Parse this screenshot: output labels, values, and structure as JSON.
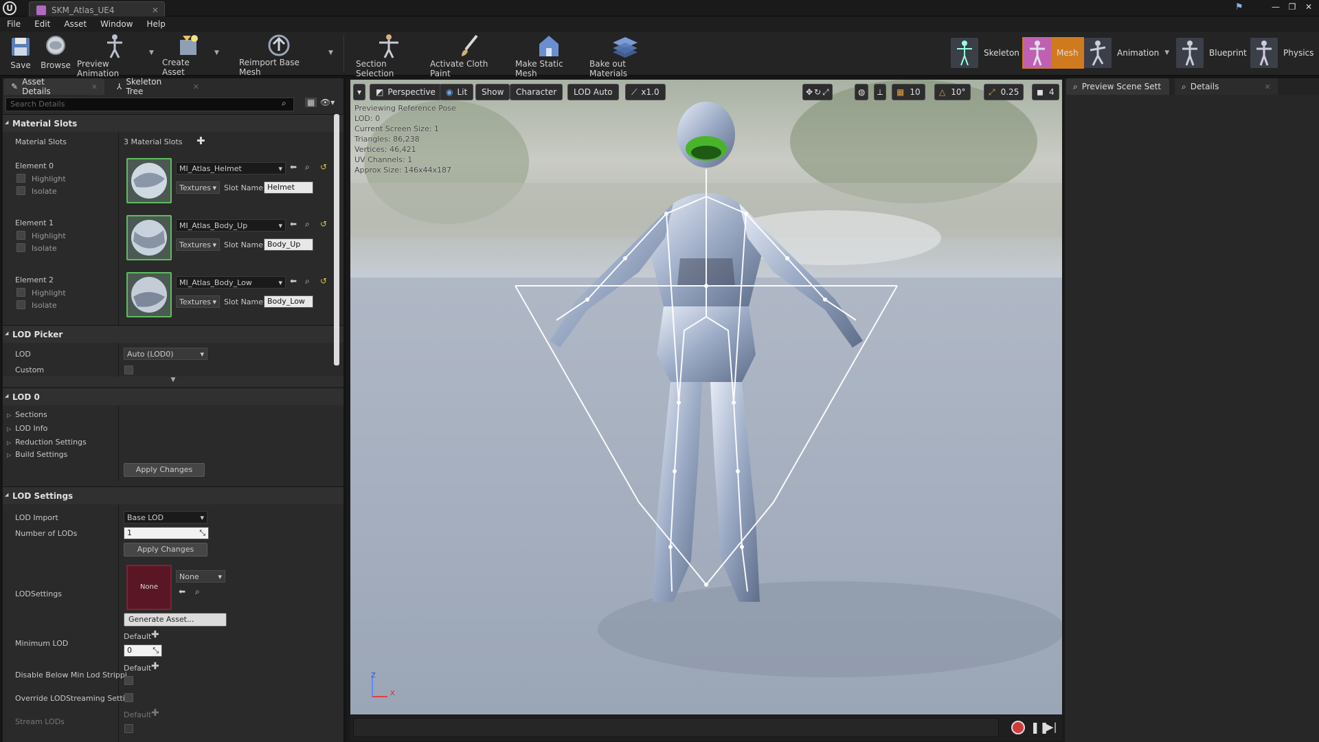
{
  "window": {
    "tab_title": "SKM_Atlas_UE4",
    "controls": [
      "—",
      "❐",
      "✕"
    ]
  },
  "menu": [
    "File",
    "Edit",
    "Asset",
    "Window",
    "Help"
  ],
  "toolbar": {
    "save": "Save",
    "browse": "Browse",
    "preview_animation": "Preview Animation",
    "create_asset": "Create Asset",
    "reimport": "Reimport Base Mesh",
    "section_selection": "Section Selection",
    "activate_cloth": "Activate Cloth Paint",
    "make_static": "Make Static Mesh",
    "bake_materials": "Bake out Materials"
  },
  "modes": {
    "skeleton": "Skeleton",
    "mesh": "Mesh",
    "animation": "Animation",
    "blueprint": "Blueprint",
    "physics": "Physics",
    "active": "Mesh"
  },
  "left_panel": {
    "tabs": [
      "Asset Details",
      "Skeleton Tree"
    ],
    "search_placeholder": "Search Details",
    "material_slots": {
      "header": "Material Slots",
      "label": "Material Slots",
      "count": "3 Material Slots",
      "elements": [
        {
          "label": "Element 0",
          "material": "MI_Atlas_Helmet",
          "slot_name": "Helmet"
        },
        {
          "label": "Element 1",
          "material": "MI_Atlas_Body_Up",
          "slot_name": "Body_Up"
        },
        {
          "label": "Element 2",
          "material": "MI_Atlas_Body_Low",
          "slot_name": "Body_Low"
        }
      ],
      "highlight": "Highlight",
      "isolate": "Isolate",
      "textures": "Textures",
      "slot_name_label": "Slot Name"
    },
    "lod_picker": {
      "header": "LOD Picker",
      "lod_label": "LOD",
      "lod_value": "Auto (LOD0)",
      "custom_label": "Custom"
    },
    "lod0": {
      "header": "LOD 0",
      "items": [
        "Sections",
        "LOD Info",
        "Reduction Settings",
        "Build Settings"
      ],
      "apply": "Apply Changes"
    },
    "lod_settings": {
      "header": "LOD Settings",
      "lod_import_label": "LOD Import",
      "lod_import_value": "Base LOD",
      "num_lods_label": "Number of LODs",
      "num_lods_value": "1",
      "apply": "Apply Changes",
      "lodsettings_label": "LODSettings",
      "lodsettings_thumb": "None",
      "lodsettings_value": "None",
      "generate": "Generate Asset...",
      "min_lod_label": "Minimum LOD",
      "default": "Default",
      "min_lod_value": "0",
      "disable_below_label": "Disable Below Min Lod Strippi",
      "override_label": "Override LODStreaming Settir",
      "stream_lods_label": "Stream LODs"
    }
  },
  "viewport": {
    "perspective": "Perspective",
    "lit": "Lit",
    "show": "Show",
    "character": "Character",
    "lod_auto": "LOD Auto",
    "speed": "x1.0",
    "grid_snap": "10",
    "rot_snap": "10°",
    "scale_snap": "0.25",
    "cam_speed": "4",
    "stats": [
      "Previewing Reference Pose",
      "LOD: 0",
      "Current Screen Size: 1",
      "Triangles: 86,238",
      "Vertices: 46,421",
      "UV Channels: 1",
      "Approx Size: 146x44x187"
    ],
    "axis_z": "Z",
    "axis_x": "X"
  },
  "right_panel": {
    "tabs": [
      "Preview Scene Sett",
      "Details"
    ]
  }
}
